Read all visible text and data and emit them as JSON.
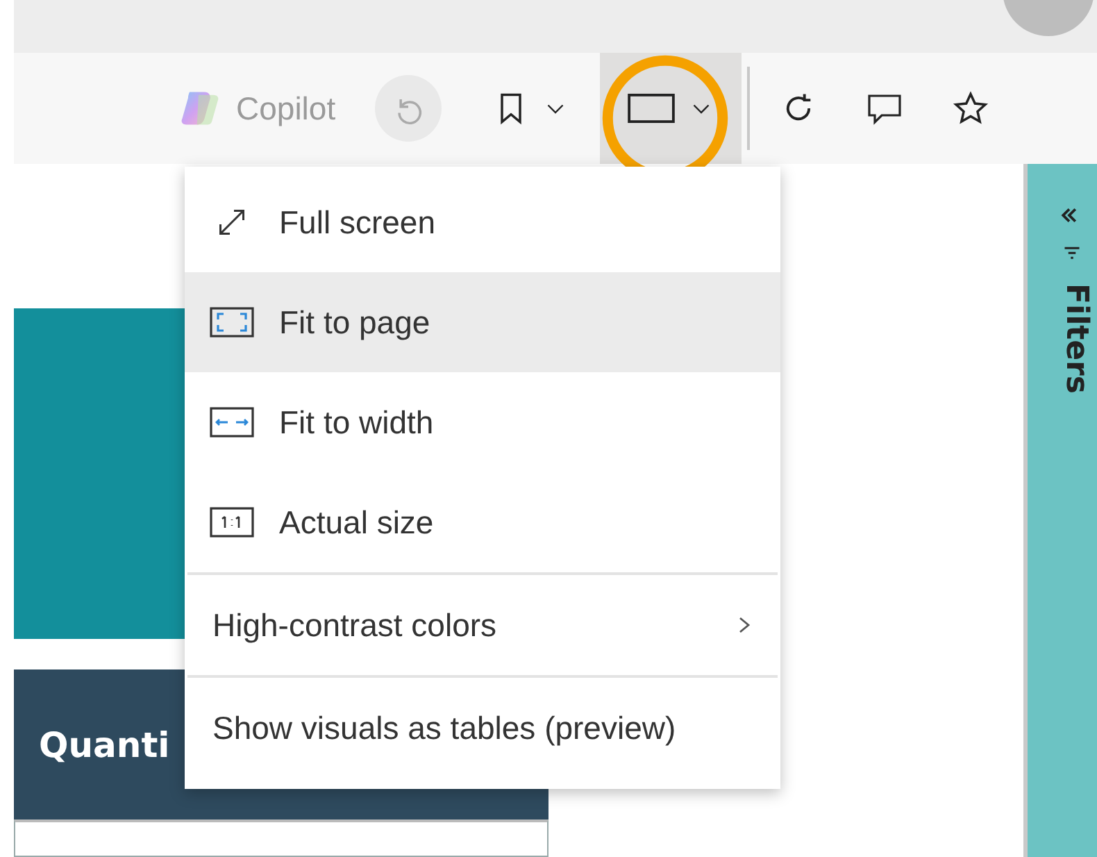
{
  "toolbar": {
    "copilot_label": "Copilot",
    "buttons": [
      {
        "kind": "undo",
        "disabled": true,
        "selected": false,
        "highlighted": false
      },
      {
        "kind": "bookmark",
        "disabled": false,
        "selected": false,
        "highlighted": false
      },
      {
        "kind": "view",
        "disabled": false,
        "selected": true,
        "highlighted": true
      },
      {
        "kind": "refresh",
        "disabled": false,
        "selected": false,
        "highlighted": false
      },
      {
        "kind": "comment",
        "disabled": false,
        "selected": false,
        "highlighted": false
      },
      {
        "kind": "favorite",
        "disabled": false,
        "selected": false,
        "highlighted": false
      }
    ]
  },
  "view_menu": {
    "sections": [
      [
        {
          "label": "Full screen",
          "selected": false,
          "submenu": false
        },
        {
          "label": "Fit to page",
          "selected": true,
          "submenu": false
        },
        {
          "label": "Fit to width",
          "selected": false,
          "submenu": false
        },
        {
          "label": "Actual size",
          "selected": false,
          "submenu": false
        }
      ],
      [
        {
          "label": "High-contrast colors",
          "selected": false,
          "submenu": true
        }
      ],
      [
        {
          "label": "Show visuals as tables (preview)",
          "selected": false,
          "submenu": false
        }
      ]
    ]
  },
  "report": {
    "header_text": "Quanti"
  },
  "filters_pane": {
    "title": "Filters",
    "collapsed": true
  }
}
